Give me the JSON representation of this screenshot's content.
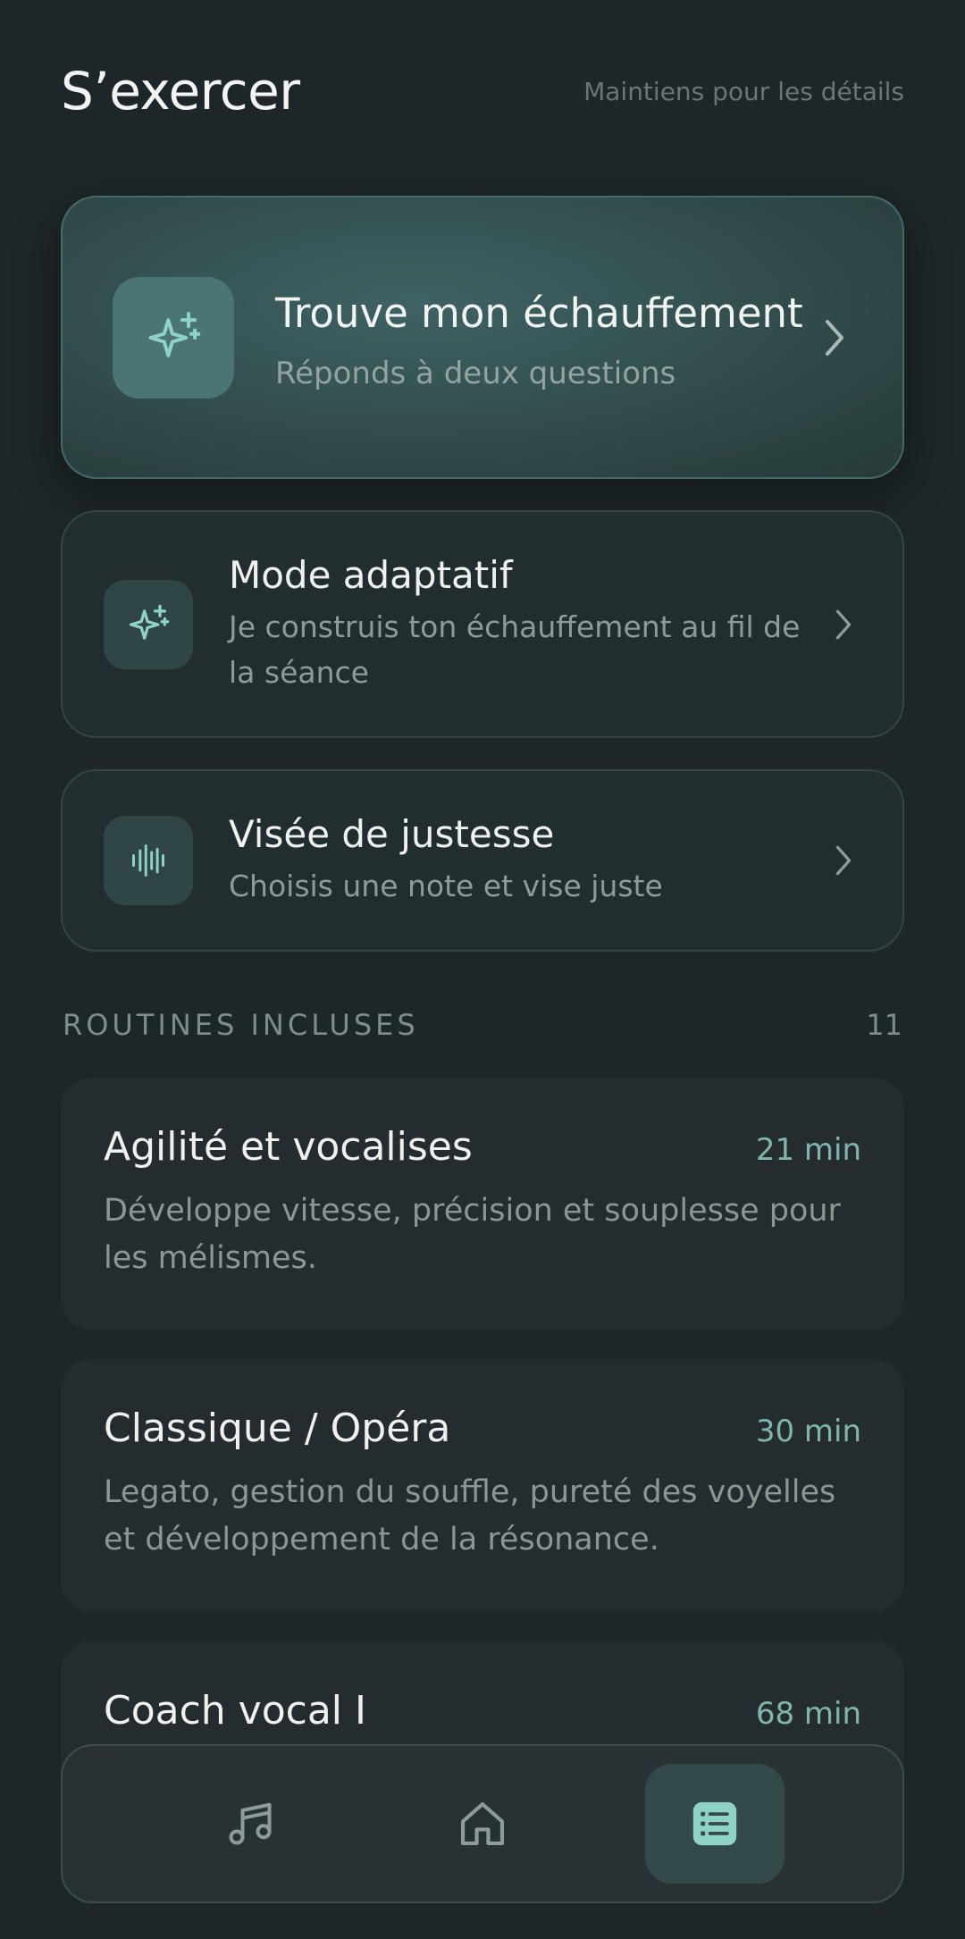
{
  "header": {
    "title": "S’exercer",
    "hint": "Maintiens pour les détails"
  },
  "hero": {
    "title": "Trouve mon échauffement",
    "subtitle": "Réponds à deux questions",
    "icon": "sparkles-icon"
  },
  "options": [
    {
      "title": "Mode adaptatif",
      "subtitle": "Je construis ton échauffement au fil de la séance",
      "icon": "sparkles-icon"
    },
    {
      "title": "Visée de justesse",
      "subtitle": "Choisis une note et vise juste",
      "icon": "waveform-icon"
    }
  ],
  "routines_section": {
    "title": "ROUTINES INCLUSES",
    "count": "11"
  },
  "routines": [
    {
      "name": "Agilité et vocalises",
      "duration": "21 min",
      "description": "Développe vitesse, précision et souplesse pour les mélismes."
    },
    {
      "name": "Classique / Opéra",
      "duration": "30 min",
      "description": "Legato, gestion du souffle, pureté des voyelles et développement de la résonance."
    },
    {
      "name": "Coach vocal I",
      "duration": "68 min",
      "description": ""
    }
  ],
  "tabbar": {
    "tabs": [
      {
        "id": "music",
        "icon": "music-note-icon",
        "active": false
      },
      {
        "id": "home",
        "icon": "home-icon",
        "active": false
      },
      {
        "id": "practice",
        "icon": "list-icon",
        "active": true
      }
    ]
  },
  "colors": {
    "background": "#1d2628",
    "accent": "#7fb5ad",
    "hero_card": "#33504f"
  }
}
